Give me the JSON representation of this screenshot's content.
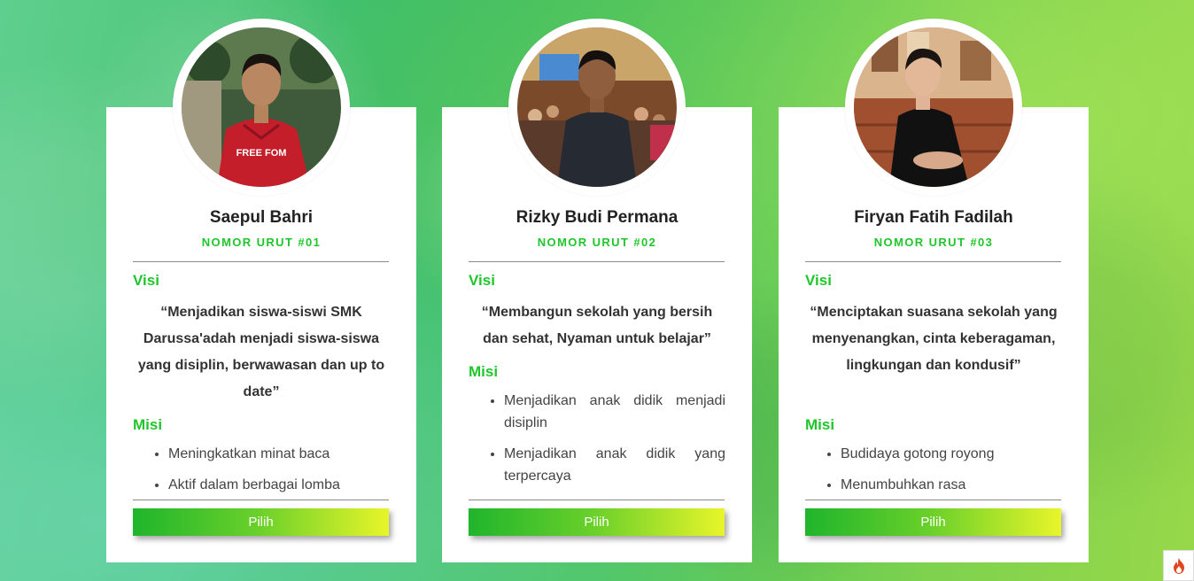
{
  "candidates": [
    {
      "name": "Saepul Bahri",
      "number": "NOMOR URUT #01",
      "visi_label": "Visi",
      "visi": "“Menjadikan siswa-siswi SMK Darussa'adah menjadi siswa-siswa yang disiplin, berwawasan dan up to date”",
      "misi_label": "Misi",
      "misi": [
        "Meningkatkan minat baca",
        "Aktif dalam berbagai lomba"
      ],
      "button": "Pilih",
      "photo": "photo-red-hoodie"
    },
    {
      "name": "Rizky Budi Permana",
      "number": "NOMOR URUT #02",
      "visi_label": "Visi",
      "visi": "“Membangun sekolah yang bersih dan sehat, Nyaman untuk belajar”",
      "misi_label": "Misi",
      "misi": [
        "Menjadikan anak didik menjadi disiplin",
        "Menjadikan anak didik yang terpercaya"
      ],
      "button": "Pilih",
      "photo": "photo-dark-shirt-event"
    },
    {
      "name": "Firyan Fatih Fadilah",
      "number": "NOMOR URUT #03",
      "visi_label": "Visi",
      "visi": "“Menciptakan suasana sekolah yang menyenangkan, cinta keberagaman, lingkungan dan kondusif”",
      "misi_label": "Misi",
      "misi": [
        "Budidaya gotong royong",
        "Menumbuhkan rasa"
      ],
      "button": "Pilih",
      "photo": "photo-black-shirt-cafe"
    }
  ],
  "colors": {
    "accent": "#1fc62b",
    "button_start": "#1fb52c",
    "button_end": "#e8f52a"
  },
  "corner_icon": "flame-icon"
}
